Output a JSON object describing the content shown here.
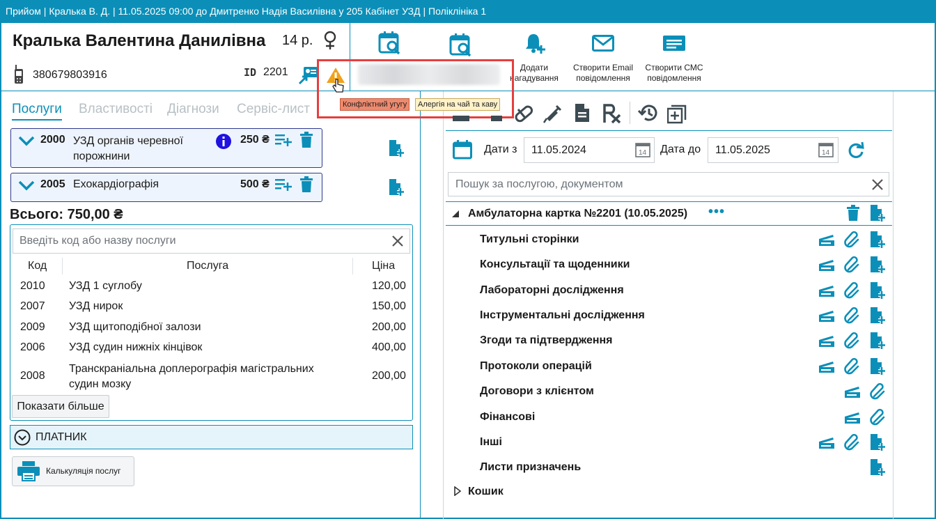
{
  "window": {
    "title": "Прийом | Кралька В. Д. | 11.05.2025 09:00 до Дмитренко Надія Василівна у 205 Кабінет УЗД | Поліклініка 1"
  },
  "patient": {
    "name": "Кралька Валентина Данилівна",
    "age": "14 р.",
    "phone": "380679803916",
    "id_label": "ID",
    "id_value": "2201"
  },
  "toolbar": {
    "reminder_label": "Додати нагадування",
    "email_label": "Створити Email повідомлення",
    "sms_label": "Створити СМС повідомлення"
  },
  "warnings": {
    "tag_conflict": "Конфліктний угугу",
    "tag_allergy": "Алергія на чай та каву"
  },
  "tabs": [
    "Послуги",
    "Властивості",
    "Діагнози",
    "Сервіс-лист"
  ],
  "selected_services": [
    {
      "code": "2000",
      "name": "УЗД органів черевної порожнини",
      "price": "250 ₴"
    },
    {
      "code": "2005",
      "name": "Ехокардіографія",
      "price": "500 ₴"
    }
  ],
  "total": "Всього: 750,00 ₴",
  "service_search": {
    "placeholder": "Введіть код або назву послуги",
    "columns": {
      "code": "Код",
      "service": "Послуга",
      "price": "Ціна"
    },
    "rows": [
      {
        "code": "2010",
        "name": "УЗД 1 суглобу",
        "price": "120,00"
      },
      {
        "code": "2007",
        "name": "УЗД нирок",
        "price": "150,00"
      },
      {
        "code": "2009",
        "name": "УЗД щитоподібної залози",
        "price": "200,00"
      },
      {
        "code": "2006",
        "name": "УЗД судин нижніх кінцівок",
        "price": "400,00"
      },
      {
        "code": "2008",
        "name": "Транскраніальна доплерографія магістральних судин мозку",
        "price": "200,00"
      }
    ],
    "show_more": "Показати більше"
  },
  "payer_label": "ПЛАТНИК",
  "calc_button": "Калькуляція послуг",
  "filter": {
    "date_from_label": "Дати з",
    "date_from": "11.05.2024",
    "date_to_label": "Дата до",
    "date_to": "11.05.2025",
    "calendar_day": "14",
    "search_placeholder": "Пошук за послугою, документом"
  },
  "tree": {
    "root": "Амбулаторна картка №2201 (10.05.2025)",
    "items": [
      "Титульні сторінки",
      "Консультації та щоденники",
      "Лабораторні дослідження",
      "Інструментальні дослідження",
      "Згоди та підтвердження",
      "Протоколи операцій",
      "Договори з клієнтом",
      "Фінансові",
      "Інші",
      "Листи призначень"
    ],
    "trash": "Кошик"
  },
  "colors": {
    "accent": "#0b8fb8",
    "card_border": "#2d3a8c",
    "warning": "#f0a21a",
    "highlight": "#e53f3f"
  }
}
